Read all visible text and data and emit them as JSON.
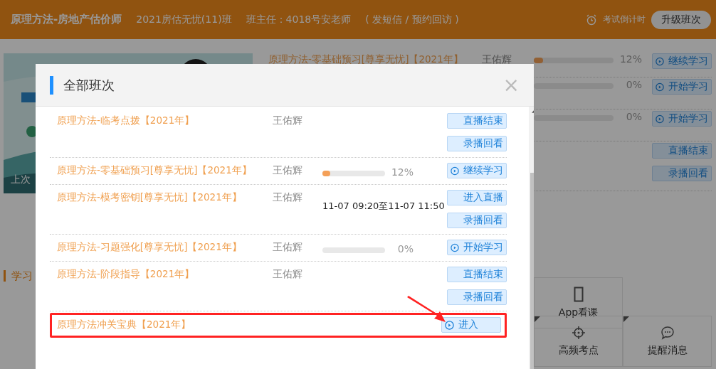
{
  "header": {
    "course_title": "原理方法-房地产估价师",
    "class_name": "2021房估无忧(11)班",
    "head_teacher": "班主任：4018号安老师",
    "contact_links": "( 发短信 / 预约回访 )",
    "countdown": "考试倒计时",
    "upgrade_button": "升级班次"
  },
  "background": {
    "banner_caption": "上次",
    "rows": [
      {
        "title": "原理方法-零基础预习[尊享无忧]【2021年】",
        "teacher": "王佑辉",
        "kind": "progress",
        "level": 0.12,
        "percent": "12%",
        "buttons": [
          {
            "label": "继续学习",
            "kind": "play"
          }
        ]
      },
      {
        "kind": "progress",
        "percent": "0%",
        "buttons": [
          {
            "label": "开始学习",
            "kind": "play"
          }
        ]
      },
      {
        "kind": "progress",
        "percent": "0%",
        "buttons": [
          {
            "label": "开始学习",
            "kind": "play"
          }
        ]
      },
      {
        "kind": "none",
        "buttons": [
          {
            "label": "直播结束",
            "kind": "plain"
          },
          {
            "label": "录播回看",
            "kind": "plain"
          }
        ]
      }
    ],
    "section_title": "学习",
    "tiles_top": [
      {
        "label": "App看课",
        "kind": "phone"
      }
    ],
    "tiles_bottom": [
      {
        "label": "高频考点",
        "kind": "target"
      },
      {
        "label": "提醒消息",
        "kind": "chat"
      }
    ]
  },
  "modal": {
    "title": "全部班次",
    "close": "×",
    "rows": [
      {
        "title": "原理方法-临考点拨【2021年】",
        "teacher": "王佑辉",
        "kind": "none",
        "highlighted": false,
        "buttons": [
          {
            "label": "直播结束",
            "kind": "plain"
          },
          {
            "label": "录播回看",
            "kind": "plain"
          }
        ]
      },
      {
        "title": "原理方法-零基础预习[尊享无忧]【2021年】",
        "teacher": "王佑辉",
        "kind": "progress",
        "level": 0.12,
        "percent": "12%",
        "highlighted": false,
        "buttons": [
          {
            "label": "继续学习",
            "kind": "play"
          }
        ]
      },
      {
        "title": "原理方法-模考密钥[尊享无忧]【2021年】",
        "teacher": "王佑辉",
        "kind": "schedule",
        "time": "11-07 09:20至11-07 11:50",
        "highlighted": false,
        "buttons": [
          {
            "label": "进入直播",
            "kind": "plain"
          },
          {
            "label": "录播回看",
            "kind": "plain"
          }
        ]
      },
      {
        "title": "原理方法-习题强化[尊享无忧]【2021年】",
        "teacher": "王佑辉",
        "kind": "progress",
        "percent": "0%",
        "highlighted": false,
        "buttons": [
          {
            "label": "开始学习",
            "kind": "play"
          }
        ]
      },
      {
        "title": "原理方法-阶段指导【2021年】",
        "teacher": "王佑辉",
        "kind": "none",
        "highlighted": false,
        "buttons": [
          {
            "label": "直播结束",
            "kind": "plain"
          },
          {
            "label": "录播回看",
            "kind": "plain"
          }
        ]
      },
      {
        "title": "原理方法冲关宝典【2021年】",
        "kind": "none",
        "highlighted": true,
        "buttons": [
          {
            "label": "进入",
            "kind": "play"
          }
        ]
      }
    ]
  }
}
